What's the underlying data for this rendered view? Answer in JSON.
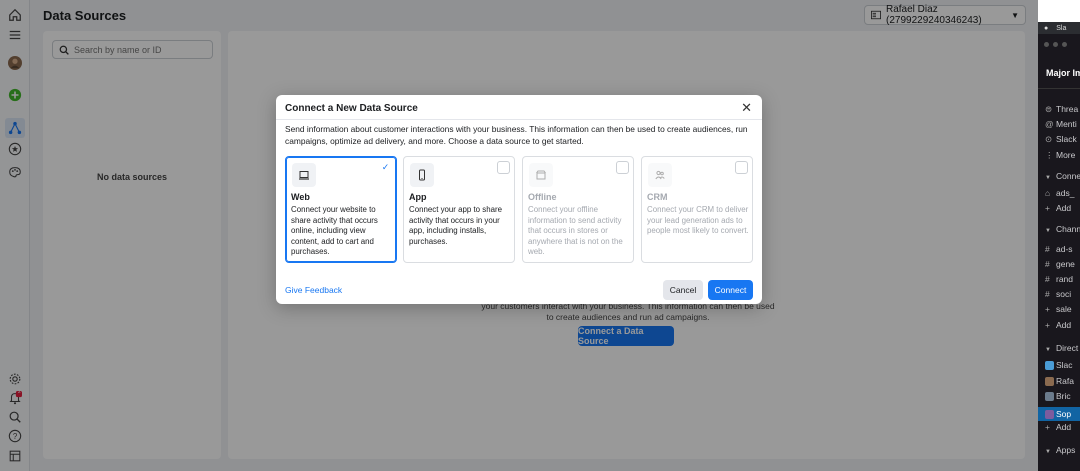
{
  "app": {
    "page_title": "Data Sources",
    "account_selector": "Rafael Diaz (2799229240346243)",
    "search": {
      "placeholder": "Search by name or ID",
      "value": ""
    },
    "empty_list_text": "No data sources",
    "main_empty": {
      "description_line1": "your customers interact with your business. This information can then be used",
      "description_line2": "to create audiences and run ad campaigns.",
      "cta_label": "Connect a Data Source"
    },
    "notification_badge": "2",
    "accent_color": "#1877f2"
  },
  "modal": {
    "title": "Connect a New Data Source",
    "close_icon": "close-icon",
    "description": "Send information about customer interactions with your business. This information can then be used to create audiences, run campaigns, optimize ad delivery, and more. Choose a data source to get started.",
    "cards": [
      {
        "name": "Web",
        "description": "Connect your website to share activity that occurs online, including view content, add to cart and purchases.",
        "icon": "laptop-icon",
        "selected": true,
        "enabled": true
      },
      {
        "name": "App",
        "description": "Connect your app to share activity that occurs in your app, including installs, purchases.",
        "icon": "phone-icon",
        "selected": false,
        "enabled": true
      },
      {
        "name": "Offline",
        "description": "Connect your offline information to send activity that occurs in stores or anywhere that is not on the web.",
        "icon": "store-icon",
        "selected": false,
        "enabled": false
      },
      {
        "name": "CRM",
        "description": "Connect your CRM to deliver your lead generation ads to people most likely to convert.",
        "icon": "people-icon",
        "selected": false,
        "enabled": false
      }
    ],
    "feedback_link": "Give Feedback",
    "cancel_label": "Cancel",
    "connect_label": "Connect"
  },
  "slack": {
    "menu_label": "Sla",
    "workspace": "Major Imp",
    "items": [
      {
        "glyph": "⊜",
        "label": "Threa"
      },
      {
        "glyph": "@",
        "label": "Menti"
      },
      {
        "glyph": "⊙",
        "label": "Slack"
      },
      {
        "glyph": "⋮",
        "label": "More"
      },
      {
        "glyph": "▼",
        "label": "Conne",
        "header": true
      },
      {
        "glyph": "⌂",
        "label": "ads_"
      },
      {
        "glyph": "+",
        "label": "Add"
      },
      {
        "glyph": "▼",
        "label": "Chann",
        "header": true
      },
      {
        "glyph": "#",
        "label": "ad-s"
      },
      {
        "glyph": "#",
        "label": "gene"
      },
      {
        "glyph": "#",
        "label": "rand"
      },
      {
        "glyph": "#",
        "label": "soci"
      },
      {
        "glyph": "+",
        "label": "sale"
      },
      {
        "glyph": "+",
        "label": "Add"
      },
      {
        "glyph": "▼",
        "label": "Direct",
        "header": true
      },
      {
        "glyph": "",
        "label": "Slac"
      },
      {
        "glyph": "",
        "label": "Rafa"
      },
      {
        "glyph": "",
        "label": "Bric"
      },
      {
        "glyph": "",
        "label": "Sop",
        "selected": true
      },
      {
        "glyph": "+",
        "label": "Add"
      },
      {
        "glyph": "▼",
        "label": "Apps",
        "header": true
      }
    ]
  }
}
